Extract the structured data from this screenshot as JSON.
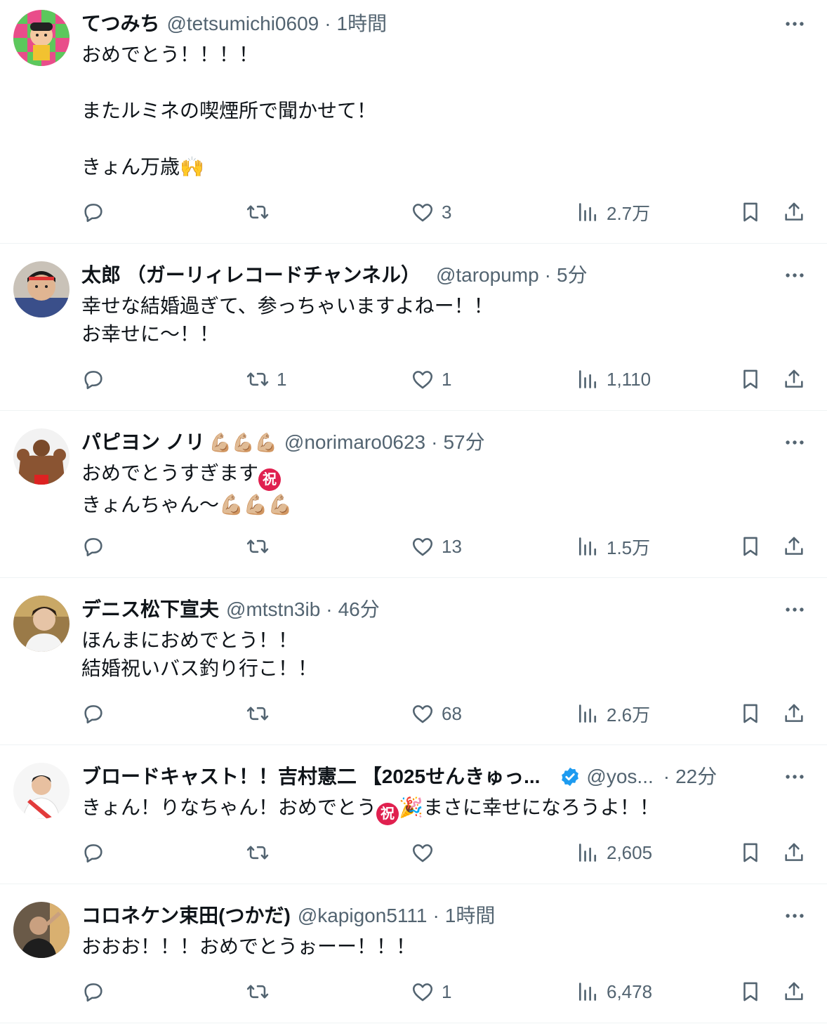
{
  "tweets": [
    {
      "name": "てつみち",
      "name_emoji": "",
      "handle": "@tetsumichi0609",
      "time": "1時間",
      "body": "おめでとう！！！！\n\nまたルミネの喫煙所で聞かせて！\n\nきょん万歳🙌",
      "reply": "",
      "retweet": "",
      "like": "3",
      "views": "2.7万"
    },
    {
      "name": "太郎 （ガーリィレコードチャンネル）",
      "name_emoji": "",
      "handle": "@taropump",
      "time": "5分",
      "body": "幸せな結婚過ぎて、参っちゃいますよねー！！\nお幸せに〜！！",
      "reply": "",
      "retweet": "1",
      "like": "1",
      "views": "1,110"
    },
    {
      "name": "パピヨン ノリ",
      "name_emoji": "💪🏼💪🏼💪🏼",
      "handle": "@norimaro0623",
      "time": "57分",
      "body_line1": "おめでとうすぎます",
      "body_line1_emoji": "祝",
      "body_line2": "きょんちゃん〜💪🏼💪🏼💪🏼",
      "reply": "",
      "retweet": "",
      "like": "13",
      "views": "1.5万"
    },
    {
      "name": "デニス松下宣夫",
      "name_emoji": "",
      "handle": "@mtstn3ib",
      "time": "46分",
      "body": "ほんまにおめでとう！！\n結婚祝いバス釣り行こ！！",
      "reply": "",
      "retweet": "",
      "like": "68",
      "views": "2.6万"
    },
    {
      "name": "ブロードキャスト！！吉村憲二 【2025せんきゅっ...",
      "name_emoji": "",
      "handle": "@yos...",
      "time": "22分",
      "body_pre": "きょん！りなちゃん！おめでとう",
      "body_emoji1": "祝",
      "body_emoji2": "🎉",
      "body_post": "まさに幸せになろうよ！！",
      "reply": "",
      "retweet": "",
      "like": "",
      "views": "2,605"
    },
    {
      "name": "コロネケン束田(つかだ)",
      "name_emoji": "",
      "handle": "@kapigon5111",
      "time": "1時間",
      "body": "おおお！！！おめでとうぉーー！！！",
      "reply": "",
      "retweet": "",
      "like": "1",
      "views": "6,478"
    }
  ],
  "separator": "·",
  "colors": {
    "text": "#0f1419",
    "secondary": "#536471",
    "divider": "#eff3f4",
    "verified": "#1d9bf0"
  },
  "icons": [
    "reply-icon",
    "retweet-icon",
    "like-icon",
    "views-icon",
    "bookmark-icon",
    "share-icon",
    "more-icon",
    "verified-badge-icon"
  ]
}
